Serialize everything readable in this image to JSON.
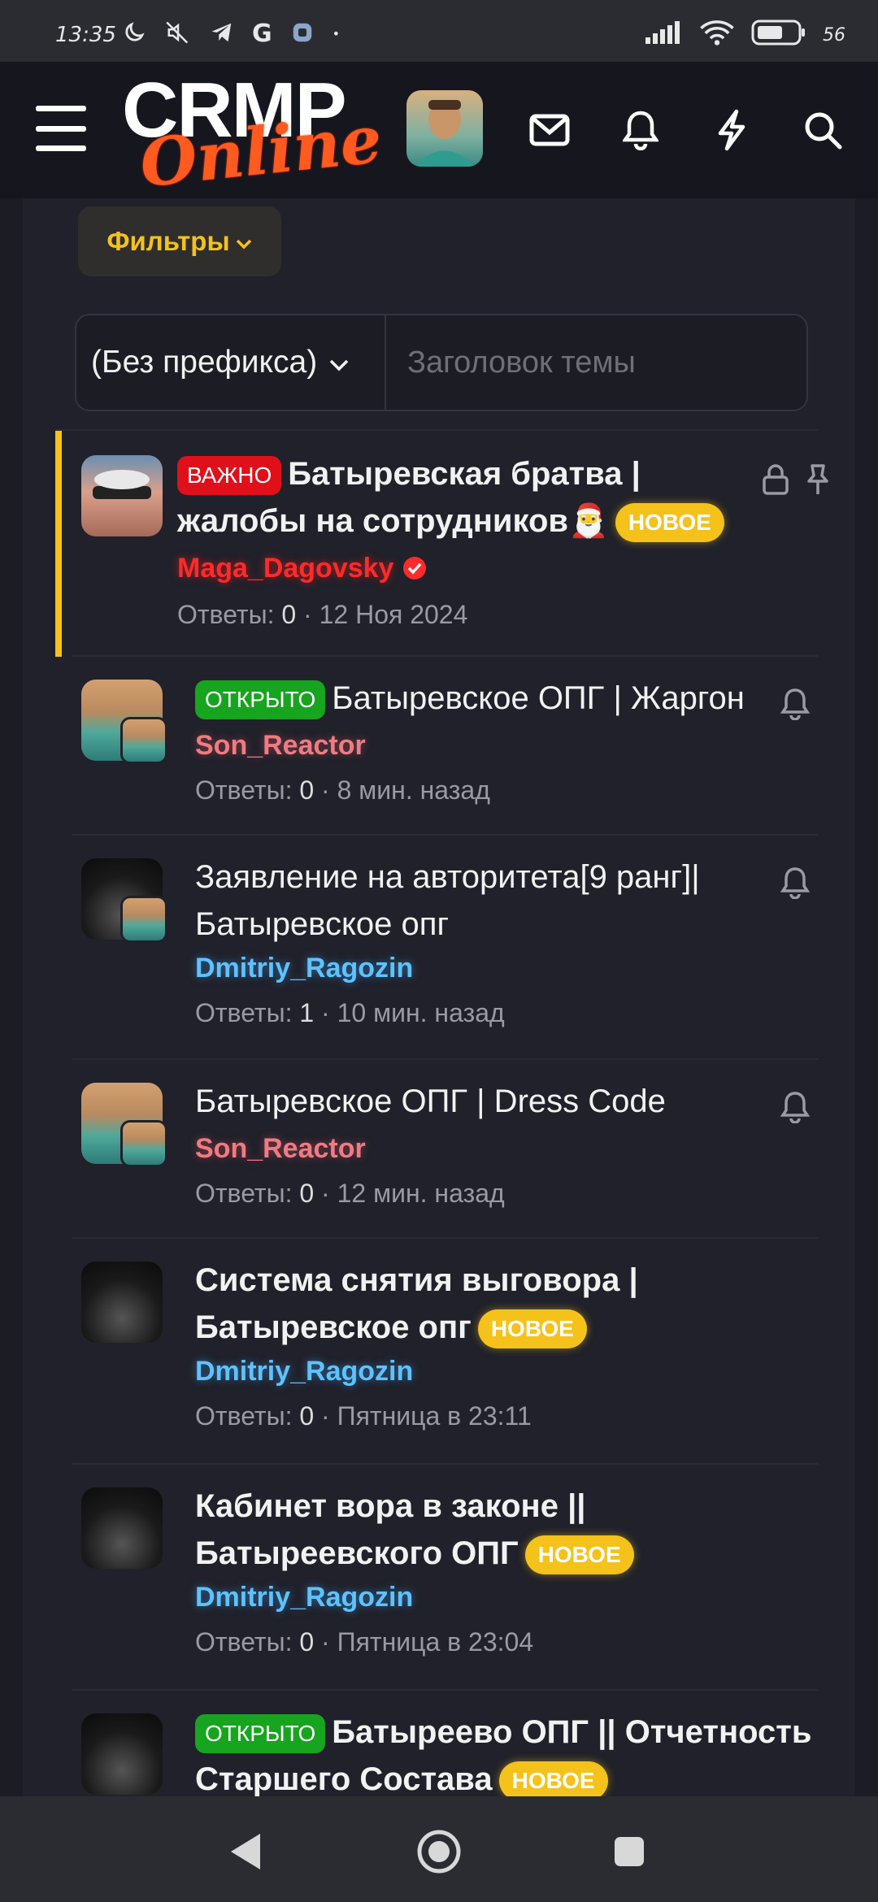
{
  "status_bar": {
    "time": "13:35",
    "battery": "56"
  },
  "header": {
    "logo_top": "CRMP",
    "logo_bottom": "Online"
  },
  "filters": {
    "label": "Фильтры"
  },
  "search": {
    "prefix": "(Без префикса)",
    "placeholder": "Заголовок темы"
  },
  "threads": [
    {
      "prefix": "ВАЖНО",
      "title": "Батыревская братва | жалобы на сотрудников🎅",
      "new_badge": "НОВОЕ",
      "author": "Maga_Dagovsky",
      "replies_label": "Ответы:",
      "replies": "0",
      "date": "12 Ноя 2024"
    },
    {
      "prefix": "ОТКРЫТО",
      "title": "Батыревское ОПГ | Жаргон",
      "author": "Son_Reactor",
      "replies_label": "Ответы:",
      "replies": "0",
      "date": "8 мин. назад"
    },
    {
      "title": "Заявление на авторитета[9 ранг]| Батыревское опг",
      "author": "Dmitriy_Ragozin",
      "replies_label": "Ответы:",
      "replies": "1",
      "date": "10 мин. назад"
    },
    {
      "title": "Батыревское ОПГ | Dress Code",
      "author": "Son_Reactor",
      "replies_label": "Ответы:",
      "replies": "0",
      "date": "12 мин. назад"
    },
    {
      "title": "Система снятия выговора | Батыревское опг",
      "new_badge": "НОВОЕ",
      "author": "Dmitriy_Ragozin",
      "replies_label": "Ответы:",
      "replies": "0",
      "date": "Пятница в 23:11"
    },
    {
      "title": "Кабинет вора в законе || Батыреевского ОПГ",
      "new_badge": "НОВОЕ",
      "author": "Dmitriy_Ragozin",
      "replies_label": "Ответы:",
      "replies": "0",
      "date": "Пятница в 23:04"
    },
    {
      "prefix": "ОТКРЫТО",
      "title": "Батыреево ОПГ || Отчетность Старшего Состава",
      "new_badge": "НОВОЕ"
    }
  ],
  "colors": {
    "accent_yellow": "#f4c21a",
    "important_red": "#e0101a",
    "open_green": "#17a41e",
    "author_blue": "#5ec2ff",
    "author_pink": "#f07b80"
  }
}
